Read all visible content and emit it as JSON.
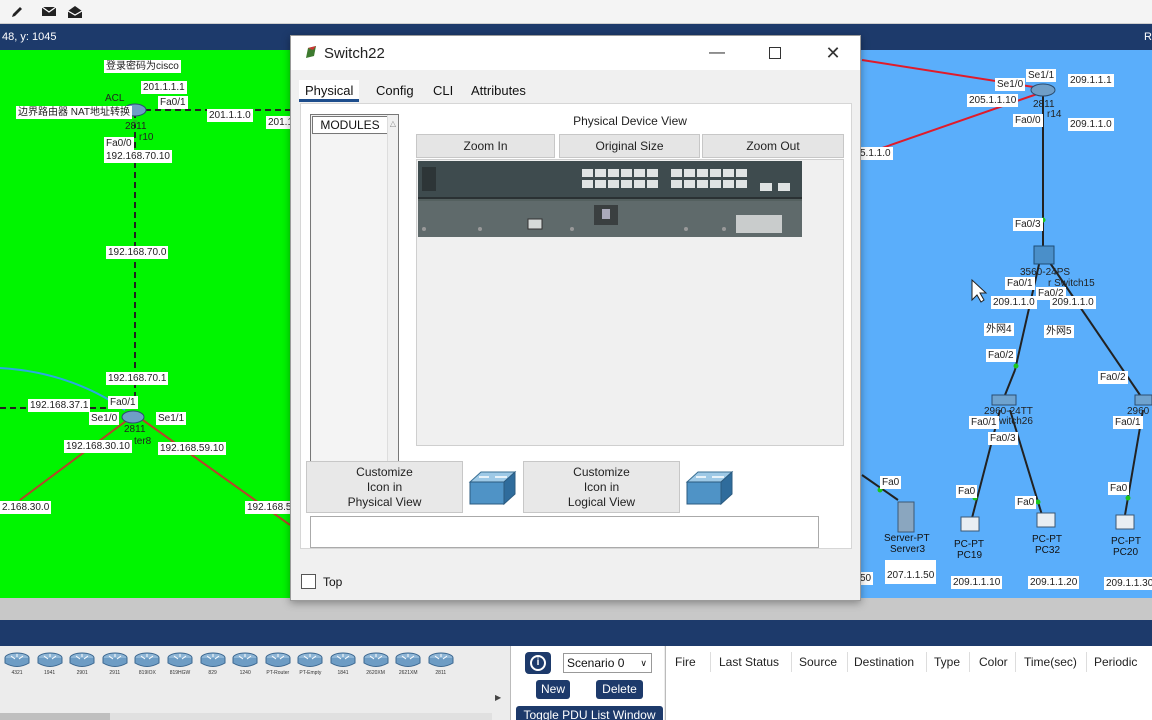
{
  "toolbar": {
    "icons": [
      "pencil-icon",
      "message-icon",
      "envelope-open-icon"
    ]
  },
  "workspace": {
    "coords_text": "48, y: 1045",
    "right_text": "R",
    "colors": {
      "green_area": "#00f500",
      "blue_area": "#5aaefb",
      "header": "#1d3a6b"
    },
    "green_labels": {
      "password_note": "登录密码为cisco",
      "acl": "ACL",
      "ip_201_1_1_1": "201.1.1.1",
      "fa0_1_top": "Fa0/1",
      "border_router_note": "边界路由器 NAT地址转换",
      "ip_201_1_1_0": "201.1.1.0",
      "ip_201_clip": "201.1",
      "model_2811_top": "2811",
      "router10_clip": "r10",
      "fa0_0_top": "Fa0/0",
      "ip_192_168_70_10": "192.168.70.10",
      "ip_192_168_70_0": "192.168.70.0",
      "ip_192_168_70_1": "192.168.70.1",
      "ip_192_168_37_1": "192.168.37.1",
      "fa0_1_mid": "Fa0/1",
      "se1_0": "Se1/0",
      "se1_1": "Se1/1",
      "model_2811_mid": "2811",
      "router8_clip": "ter8",
      "ip_192_168_30_10": "192.168.30.10",
      "ip_192_168_59_10": "192.168.59.10",
      "ip_192_168_30_0_clip": "2.168.30.0",
      "ip_192_168_5_clip": "192.168.5"
    },
    "blue_labels": {
      "ip_1_1_0_clip": "5.1.1.0",
      "se1_0_r": "Se1/0",
      "se1_1_r": "Se1/1",
      "ip_209_1_1_1_top": "209.1.1.1",
      "ip_205_1_1_10": "205.1.1.10",
      "model_2811_r": "2811",
      "router14_clip": "r14",
      "fa0_0_r": "Fa0/0",
      "ip_209_1_1_0_top": "209.1.1.0",
      "fa0_3_r": "Fa0/3",
      "model_3560": "3560-24PS",
      "fa0_1_ms": "Fa0/1",
      "multilayer_clip": "r Switch15",
      "fa0_2_ms": "Fa0/2",
      "ip_209_1_1_0_left": "209.1.1.0",
      "ip_209_1_1_0_right": "209.1.1.0",
      "wan4": "外网4",
      "wan5": "外网5",
      "fa0_2_left": "Fa0/2",
      "fa0_2_right": "Fa0/2",
      "model_2960_left": "2960-24TT",
      "switch26_clip": "witch26",
      "fa0_1_sw26": "Fa0/1",
      "fa0_3_sw26": "Fa0/3",
      "model_2960_right": "2960",
      "fa0_1_right": "Fa0/1",
      "fa0_server": "Fa0",
      "fa0_pc19": "Fa0",
      "fa0_pc32": "Fa0",
      "fa0_pc20": "Fa0",
      "server_type": "Server-PT",
      "server_name": "Server3",
      "pc19_type": "PC-PT",
      "pc19_name": "PC19",
      "pc32_type": "PC-PT",
      "pc32_name": "PC32",
      "pc20_type": "PC-PT",
      "pc20_name": "PC20",
      "ip_left_clip": "50",
      "ip_207_1_1_50": "207.1.1.50",
      "ip_209_1_1_10": "209.1.1.10",
      "ip_209_1_1_20": "209.1.1.20",
      "ip_209_1_1_30": "209.1.1.30"
    }
  },
  "dialog": {
    "title": "Switch22",
    "tabs": [
      "Physical",
      "Config",
      "CLI",
      "Attributes"
    ],
    "active_tab": "Physical",
    "modules_header": "MODULES",
    "view_title": "Physical Device View",
    "zoom_in": "Zoom In",
    "original_size": "Original Size",
    "zoom_out": "Zoom Out",
    "customize_physical": "Customize\nIcon in\nPhysical View",
    "customize_logical": "Customize\nIcon in\nLogical View",
    "top_label": "Top",
    "top_checked": false
  },
  "bottom": {
    "device_tiles": [
      "4321",
      "1941",
      "2901",
      "2911",
      "819IOX",
      "819HGW",
      "829",
      "1240",
      "PT-Router",
      "PT-Empty",
      "1841",
      "2620XM",
      "2621XM",
      "2811"
    ],
    "scenario": "Scenario 0",
    "new_label": "New",
    "delete_label": "Delete",
    "toggle_label": "Toggle PDU List Window",
    "pdu_columns": [
      "Fire",
      "Last Status",
      "Source",
      "Destination",
      "Type",
      "Color",
      "Time(sec)",
      "Periodic"
    ]
  }
}
